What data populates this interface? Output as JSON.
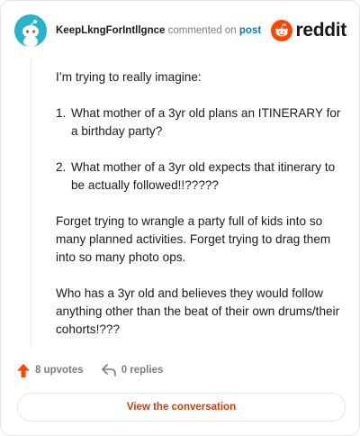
{
  "header": {
    "username": "KeepLkngForIntllgnce",
    "verb": "commented on",
    "link_label": "post",
    "logo_text": "reddit"
  },
  "comment": {
    "intro": "I’m trying to really imagine:",
    "list": [
      {
        "num": "1.",
        "text": "What mother of a 3yr old plans an ITINERARY for a birthday party?"
      },
      {
        "num": "2.",
        "text": "What mother of a 3yr old expects that itinerary to be actually followed!!?????"
      }
    ],
    "paragraph_2": "Forget trying to wrangle a party full of kids into so many planned activities. Forget trying to drag them into so many photo ops.",
    "paragraph_3": "Who has a 3yr old and believes they would follow anything other than the beat of their own drums/their cohorts!???"
  },
  "footer": {
    "upvotes": "8 upvotes",
    "replies": "0 replies",
    "view_button": "View the conversation"
  },
  "colors": {
    "avatar_bg": "#28b3c9",
    "reddit_orange": "#ff4500",
    "upvote_arrow": "#ff4500",
    "link_blue": "#0079d3",
    "button_text": "#d93a00"
  }
}
